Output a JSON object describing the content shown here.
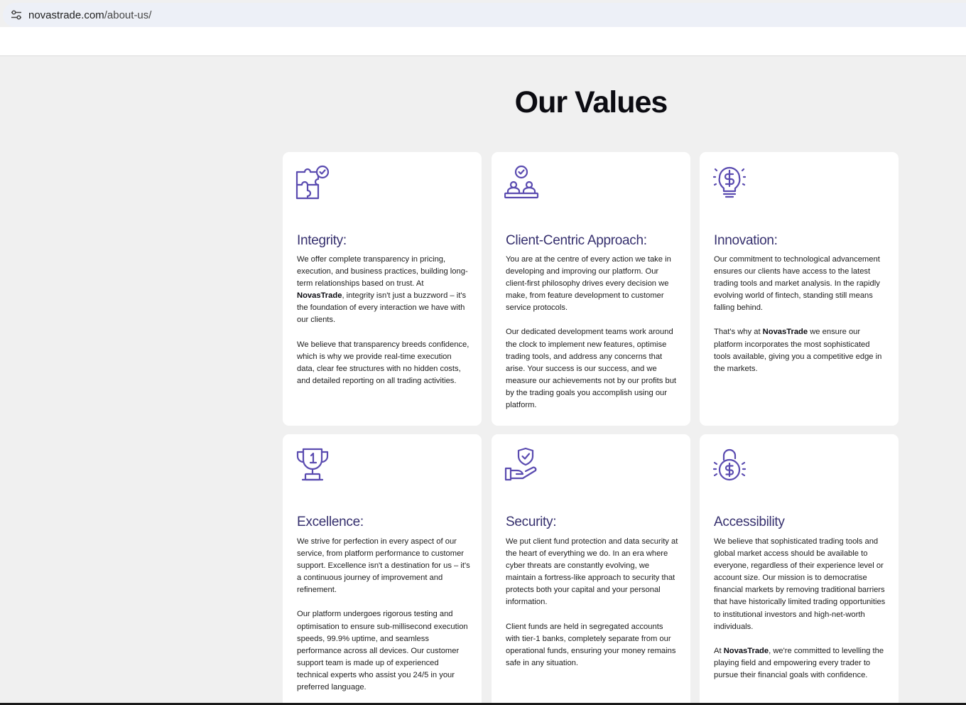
{
  "browser": {
    "url_domain": "novastrade.com",
    "url_path": "/about-us/",
    "site_info_icon": "tune-icon"
  },
  "section": {
    "title": "Our Values"
  },
  "brand": {
    "name": "NovasTrade",
    "accent_color": "#5a4bb0",
    "heading_color": "#36306e"
  },
  "values": [
    {
      "icon": "puzzle-check-icon",
      "title": "Integrity:",
      "p1": "We offer complete transparency in pricing, execution, and business practices, building long-term relationships based on trust. At ",
      "brand": "NovasTrade",
      "p1_after": ", integrity isn't just a buzzword – it's the foundation of every interaction we have with our clients.",
      "p2": "We believe that transparency breeds confidence, which is why we provide real-time execution data, clear fee structures with no hidden costs, and detailed reporting on all trading activities."
    },
    {
      "icon": "people-check-icon",
      "title": "Client-Centric Approach:",
      "p1": "You are at the centre of every action we take in developing and improving our platform. Our client-first philosophy drives every decision we make, from feature development to customer service protocols.",
      "p2": "Our dedicated development teams work around the clock to implement new features, optimise trading tools, and address any concerns that arise. Your success is our success, and we measure our achievements not by our profits but by the trading goals you accomplish using our platform."
    },
    {
      "icon": "lightbulb-dollar-icon",
      "title": "Innovation:",
      "p1": "Our commitment to technological advancement ensures our clients have access to the latest trading tools and market analysis. In the rapidly evolving world of fintech, standing still means falling behind.",
      "p2_before": "That's why at ",
      "brand": "NovasTrade",
      "p2_after": " we ensure our platform incorporates the most sophisticated tools available, giving you a competitive edge in the markets."
    },
    {
      "icon": "trophy-icon",
      "title": "Excellence:",
      "p1": "We strive for perfection in every aspect of our service, from platform performance to customer support. Excellence isn't a destination for us – it's a continuous journey of improvement and refinement.",
      "p2": "Our platform undergoes rigorous testing and optimisation to ensure sub-millisecond execution speeds, 99.9% uptime, and seamless performance across all devices. Our customer support team is made up of experienced technical experts who assist you 24/5 in your preferred language."
    },
    {
      "icon": "hand-shield-icon",
      "title": "Security:",
      "p1": "We put client fund protection and data security at the heart of everything we do. In an era where cyber threats are constantly evolving, we maintain a fortress-like approach to security that protects both your capital and your personal information.",
      "p2": "Client funds are held in segregated accounts with tier-1 banks, completely separate from our operational funds, ensuring your money remains safe in any situation."
    },
    {
      "icon": "unlock-dollar-icon",
      "title": "Accessibility",
      "p1": "We believe that sophisticated trading tools and global market access should be available to everyone, regardless of their experience level or account size. Our mission is to democratise financial markets by removing traditional barriers that have historically limited trading opportunities to institutional investors and high-net-worth individuals.",
      "p2_before": "At ",
      "brand": "NovasTrade",
      "p2_after": ", we're committed to levelling the playing field and empowering every trader to pursue their financial goals with confidence."
    }
  ]
}
